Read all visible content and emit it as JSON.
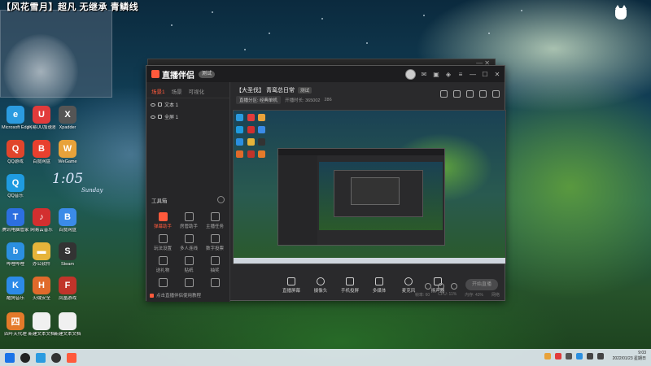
{
  "stream_title": "【风花雪月】超凡 无继承 青鳞线",
  "desktop": {
    "icons": [
      {
        "label": "Microsoft Edge",
        "color": "#2b9be0",
        "glyph": "e"
      },
      {
        "label": "网易UU加速器",
        "color": "#e23b3b",
        "glyph": "U"
      },
      {
        "label": "Xpadder",
        "color": "#555",
        "glyph": "X"
      },
      {
        "label": "QQ游戏",
        "color": "#e0452c",
        "glyph": "Q"
      },
      {
        "label": "百度网盘",
        "color": "#e8402e",
        "glyph": "B"
      },
      {
        "label": "WeGame",
        "color": "#e8a23a",
        "glyph": "W"
      },
      {
        "label": "QQ音乐",
        "color": "#1f9be0",
        "glyph": "Q"
      },
      {
        "label": "腾讯电脑管家",
        "color": "#2c6fe0",
        "glyph": "T"
      },
      {
        "label": "网易云音乐",
        "color": "#d32f2f",
        "glyph": "♪"
      },
      {
        "label": "百度网盘",
        "color": "#3b8be8",
        "glyph": "B"
      },
      {
        "label": "哔哩哔哩",
        "color": "#2b8fe0",
        "glyph": "b"
      },
      {
        "label": "办公软件",
        "color": "#e6b43a",
        "glyph": "▬"
      },
      {
        "label": "Steam",
        "color": "#333",
        "glyph": "S"
      },
      {
        "label": "酷狗音乐",
        "color": "#2c8ae8",
        "glyph": "K"
      },
      {
        "label": "火绒安全",
        "color": "#e06a2b",
        "glyph": "H"
      },
      {
        "label": "凤凰游戏",
        "color": "#c1342a",
        "glyph": "F"
      },
      {
        "label": "四叶天代理",
        "color": "#e47a2a",
        "glyph": "四"
      },
      {
        "label": "新建文本文档",
        "color": "#f0f0f0",
        "glyph": ""
      },
      {
        "label": "新建文本文档",
        "color": "#f0f0f0",
        "glyph": ""
      }
    ],
    "clock_widget": {
      "time": "1:05",
      "day": "Sunday"
    }
  },
  "app": {
    "name": "直播伴侣",
    "version": "测试",
    "scene_tabs": [
      "场景1",
      "场景",
      "可视化"
    ],
    "layers": [
      "文本 1",
      "全屏 1"
    ],
    "tools_title": "工具箱",
    "tools": [
      {
        "label": "弹幕助手",
        "hot": true
      },
      {
        "label": "房管助手",
        "hot": false
      },
      {
        "label": "主播任务",
        "hot": false
      },
      {
        "label": "玩法设置",
        "hot": false
      },
      {
        "label": "多人连线",
        "hot": false
      },
      {
        "label": "数字投票",
        "hot": false
      },
      {
        "label": "送礼物",
        "hot": false
      },
      {
        "label": "贴纸",
        "hot": false
      },
      {
        "label": "抽奖",
        "hot": false
      },
      {
        "label": "",
        "hot": false
      },
      {
        "label": "",
        "hot": false
      },
      {
        "label": "",
        "hot": false
      }
    ],
    "left_footer": "点击直播伴侣使用教程",
    "room_title": "【大圣伐】 青鸾总日常",
    "room_badge": "测试",
    "room_sub": [
      "直播分区: 经典单机",
      "开播时长: 365002",
      "286"
    ],
    "bottom_tools": [
      {
        "label": "直播屏幕"
      },
      {
        "label": "摄像头"
      },
      {
        "label": "手机投屏"
      },
      {
        "label": "多媒体"
      },
      {
        "label": "麦克风"
      },
      {
        "label": "扬声器"
      }
    ],
    "start_live": "开始直播",
    "status": [
      "帧率: 60",
      "CPU: 11%",
      "内存: 43%",
      "网络"
    ]
  },
  "taskbar": {
    "time": "9:03",
    "date": "2022/01/23 星期日"
  }
}
